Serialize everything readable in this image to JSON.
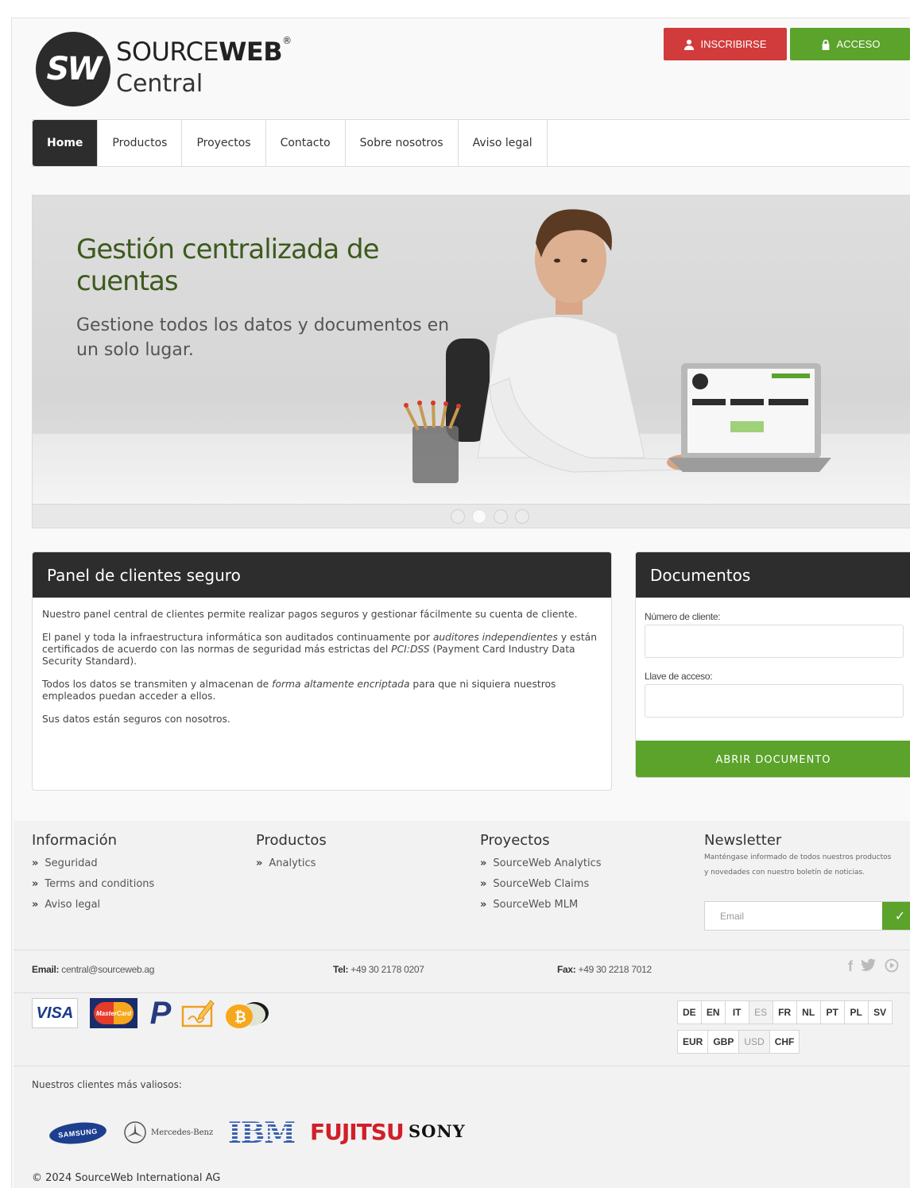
{
  "header": {
    "logo_mark": "SW",
    "brand_light": "SOURCE",
    "brand_bold": "WEB",
    "brand_reg": "®",
    "brand_sub": "Central",
    "signup_label": "INSCRIBIRSE",
    "login_label": "ACCESO"
  },
  "nav": {
    "items": [
      "Home",
      "Productos",
      "Proyectos",
      "Contacto",
      "Sobre nosotros",
      "Aviso legal"
    ],
    "active_index": 0
  },
  "hero": {
    "title": "Gestión centralizada de cuentas",
    "subtitle": "Gestione todos los datos y documentos en un solo lugar.",
    "slides": 4,
    "active_slide": 1
  },
  "panel_left": {
    "title": "Panel de clientes seguro",
    "p1": "Nuestro panel central de clientes permite realizar pagos seguros y gestionar fácilmente su cuenta de cliente.",
    "p2_a": "El panel y toda la infraestructura informática son auditados continuamente por ",
    "p2_em1": "auditores independientes",
    "p2_b": " y están certificados de acuerdo con las normas de seguridad más estrictas del ",
    "p2_em2": "PCI:DSS",
    "p2_c": " (Payment Card Industry Data Security Standard).",
    "p3_a": "Todos los datos se transmiten y almacenan de ",
    "p3_em": "forma altamente encriptada",
    "p3_b": " para que ni siquiera nuestros empleados puedan acceder a ellos.",
    "p4": "Sus datos están seguros con nosotros."
  },
  "panel_right": {
    "title": "Documentos",
    "customer_label": "Número de cliente:",
    "customer_value": "",
    "key_label": "Llave de acceso:",
    "key_value": "",
    "submit_label": "ABRIR DOCUMENTO"
  },
  "footer": {
    "info_title": "Información",
    "info_links": [
      "Seguridad",
      "Terms and conditions",
      "Aviso legal"
    ],
    "products_title": "Productos",
    "products_links": [
      "Analytics"
    ],
    "projects_title": "Proyectos",
    "projects_links": [
      "SourceWeb Analytics",
      "SourceWeb Claims",
      "SourceWeb MLM"
    ],
    "newsletter_title": "Newsletter",
    "newsletter_text": "Manténgase informado de todos nuestros productos y novedades con nuestro boletín de noticias.",
    "newsletter_placeholder": "Email",
    "email_label": "Email:",
    "email_value": "central@sourceweb.ag",
    "tel_label": "Tel:",
    "tel_value": "+49 30 2178 0207",
    "fax_label": "Fax:",
    "fax_value": "+49 30 2218 7012",
    "social_icons": [
      "facebook-icon",
      "twitter-icon",
      "play-icon"
    ],
    "payments": {
      "visa": "VISA",
      "mastercard": "MasterCard",
      "paypal": "P",
      "cheque": "cheque-icon",
      "bitcoin": "bitcoin-icon"
    },
    "languages": [
      "DE",
      "EN",
      "IT",
      "ES",
      "FR",
      "NL",
      "PT",
      "PL",
      "SV"
    ],
    "language_selected": "ES",
    "currencies": [
      "EUR",
      "GBP",
      "USD",
      "CHF"
    ],
    "currency_selected": "USD",
    "clients_label": "Nuestros clientes más valiosos:",
    "clients": {
      "samsung": "SAMSUNG",
      "mercedes": "Mercedes-Benz",
      "ibm": "IBM",
      "fujitsu": "FUJITSU",
      "sony": "SONY"
    },
    "copyright": "© 2024 SourceWeb International AG"
  },
  "colors": {
    "dark": "#2d2d2d",
    "green": "#5ba32b",
    "red": "#d23b3b",
    "hero_title": "#3d5a1e"
  }
}
